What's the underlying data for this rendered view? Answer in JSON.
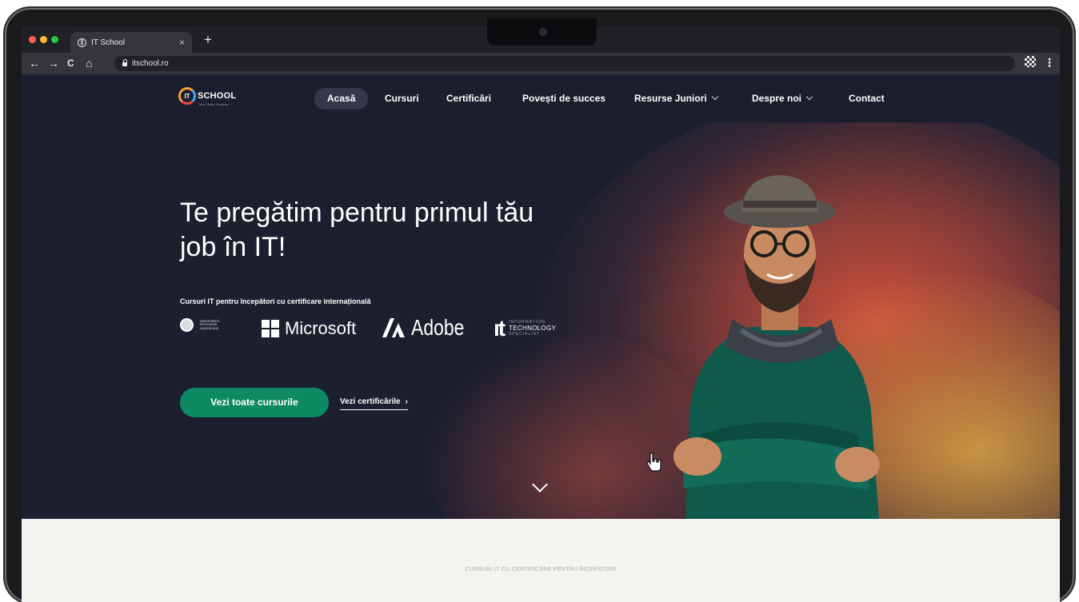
{
  "browser": {
    "tab_title": "IT School",
    "tab_close": "×",
    "new_tab": "+",
    "url": "itschool.ro",
    "controls": {
      "back": "←",
      "forward": "→",
      "reload": "C",
      "home": "⌂"
    },
    "menu": "⋮",
    "traffic_lights": [
      "#ff5f57",
      "#febc2e",
      "#28c840"
    ]
  },
  "site": {
    "logo": {
      "text": "SCHOOL",
      "badge": "IT",
      "tagline": "Tech. Skills. Success."
    },
    "nav": [
      {
        "label": "Acasă",
        "active": true
      },
      {
        "label": "Cursuri"
      },
      {
        "label": "Certificări"
      },
      {
        "label": "Povești de succes"
      },
      {
        "label": "Resurse Juniori",
        "dropdown": true
      },
      {
        "label": "Despre noi",
        "dropdown": true
      },
      {
        "label": "Contact"
      }
    ],
    "hero": {
      "title": "Te pregătim pentru primul tău job în IT!",
      "subtitle": "Cursuri IT pentru începători cu certificare internațională",
      "partners": {
        "ministry": "MINISTERUL EDUCAȚIEI NAȚIONALE",
        "microsoft": "Microsoft",
        "adobe": "Adobe",
        "its_mark": "ıt",
        "its_line1": "INFORMATION",
        "its_line2": "TECHNOLOGY",
        "its_line3": "SPECIALIST"
      },
      "cta_primary": "Vezi toate cursurile",
      "cta_secondary": "Vezi certificările",
      "cta_secondary_arrow": "›"
    },
    "section_label": "CURSURI IT CU CERTIFICARE PENTRU ÎNCEPĂTORI",
    "colors": {
      "accent": "#0e8a63",
      "hero_bg": "#1c1f2e",
      "nav_active_bg": "#34384a"
    }
  }
}
